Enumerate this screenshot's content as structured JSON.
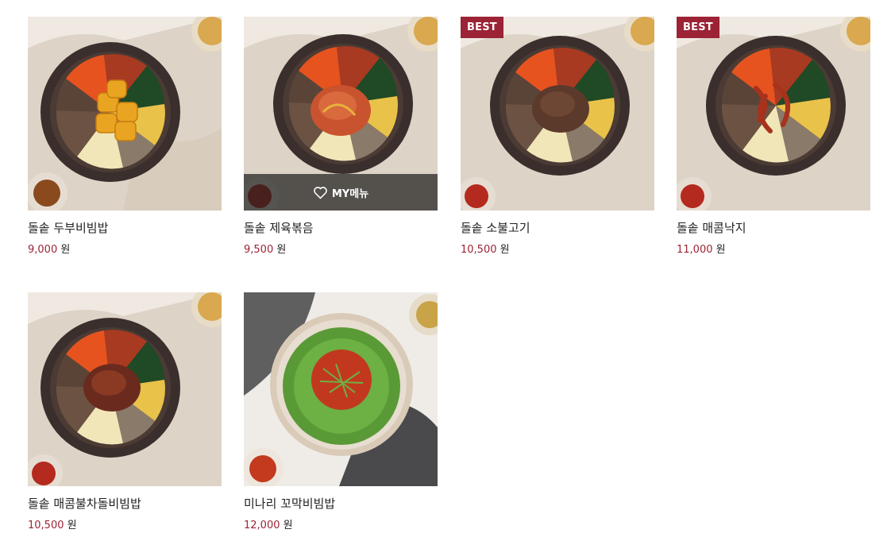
{
  "colors": {
    "accent": "#9b2335",
    "overlay": "#1e1e1e",
    "text": "#222222"
  },
  "currency": "원",
  "my_menu_label": "MY메뉴",
  "products": [
    {
      "name": "돌솥 두부비빔밥",
      "price": "9,000",
      "badge": "",
      "topping": "tofu",
      "hover": false
    },
    {
      "name": "돌솥 제육볶음",
      "price": "9,500",
      "badge": "",
      "topping": "pork",
      "hover": true
    },
    {
      "name": "돌솥 소불고기",
      "price": "10,500",
      "badge": "BEST",
      "topping": "beef",
      "hover": false
    },
    {
      "name": "돌솥 매콤낙지",
      "price": "11,000",
      "badge": "BEST",
      "topping": "octopus",
      "hover": false
    },
    {
      "name": "돌솥 매콤불차돌비빔밥",
      "price": "10,500",
      "badge": "",
      "topping": "brisket",
      "hover": false
    },
    {
      "name": "미나리 꼬막비빔밥",
      "price": "12,000",
      "badge": "",
      "topping": "cockle",
      "hover": false
    }
  ]
}
